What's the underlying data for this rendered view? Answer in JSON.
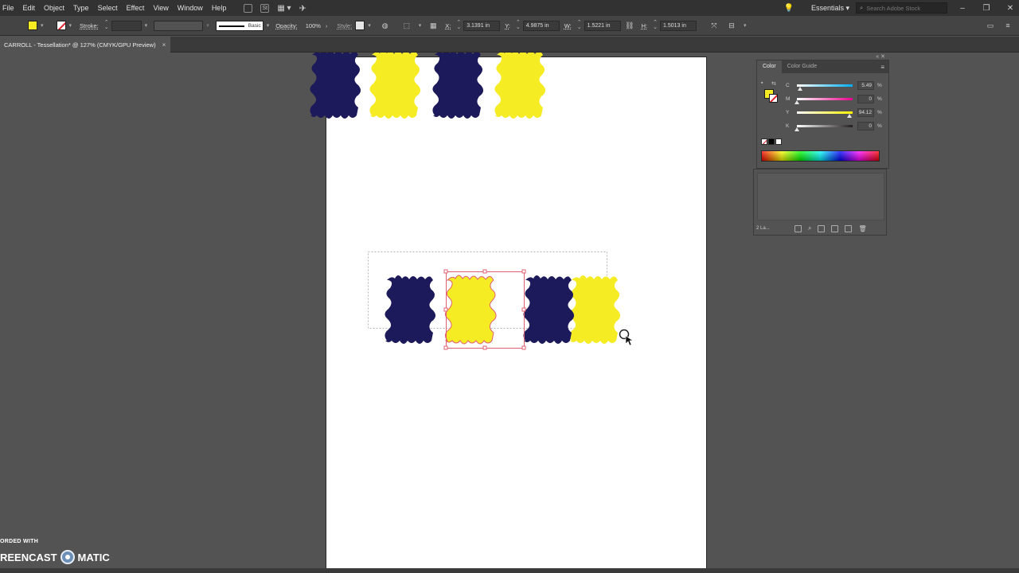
{
  "menubar": {
    "items": [
      "File",
      "Edit",
      "Object",
      "Type",
      "Select",
      "Effect",
      "View",
      "Window",
      "Help"
    ],
    "stock_badge": "St",
    "workspace": "Essentials",
    "search_placeholder": "Search Adobe Stock"
  },
  "control": {
    "stroke_label": "Stroke:",
    "stroke_profile": "Basic",
    "opacity_label": "Opacity:",
    "opacity_value": "100%",
    "style_label": "Style:",
    "x_label": "X:",
    "x_value": "3.1391 in",
    "y_label": "Y:",
    "y_value": "4.9875 in",
    "w_label": "W:",
    "w_value": "1.5221 in",
    "h_label": "H:",
    "h_value": "1.5013 in",
    "fill_color": "#f5ec24"
  },
  "document": {
    "tab_title": "CARROLL - Tessellation* @ 127% (CMYK/GPU Preview)",
    "close_glyph": "×"
  },
  "colors": {
    "navy": "#1d1a5c",
    "yellow": "#f5ec24",
    "selection": "#e06070"
  },
  "color_panel": {
    "tabs": [
      "Color",
      "Color Guide"
    ],
    "sliders": [
      {
        "label": "C",
        "value": "5.49",
        "fraction": 0.055,
        "gradient": "linear-gradient(to right,#fff,#00aeef)"
      },
      {
        "label": "M",
        "value": "0",
        "fraction": 0.0,
        "gradient": "linear-gradient(to right,#fff,#ec008c)"
      },
      {
        "label": "Y",
        "value": "94.12",
        "fraction": 0.94,
        "gradient": "linear-gradient(to right,#fff,#fff200)"
      },
      {
        "label": "K",
        "value": "0",
        "fraction": 0.0,
        "gradient": "linear-gradient(to right,#fff,#231f20)"
      }
    ],
    "percent": "%"
  },
  "layers_panel": {
    "count_label": "2 La..."
  },
  "watermark": {
    "top": "ORDED WITH",
    "left": "REENCAST",
    "right": "MATIC"
  }
}
